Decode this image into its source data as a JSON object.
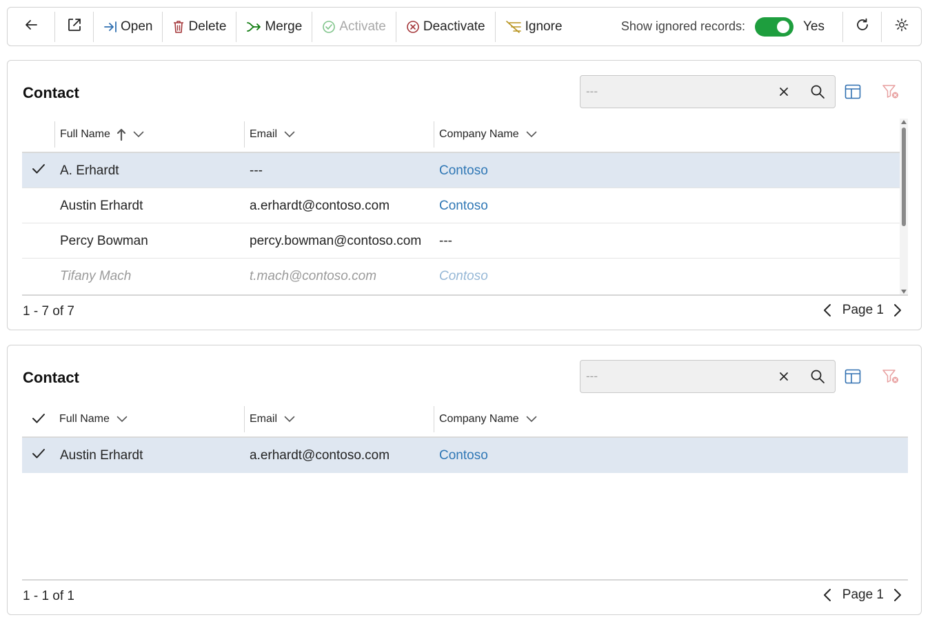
{
  "toolbar": {
    "open_label": "Open",
    "delete_label": "Delete",
    "merge_label": "Merge",
    "activate_label": "Activate",
    "deactivate_label": "Deactivate",
    "ignore_label": "Ignore",
    "show_ignored_label": "Show ignored records:",
    "show_ignored_value": "Yes",
    "colors": {
      "delete": "#a4373a",
      "merge": "#107c10",
      "activate": "#7fc48a",
      "deactivate": "#a4373a",
      "ignore": "#b8941f",
      "toggle": "#1e9e3e"
    }
  },
  "panel1": {
    "title": "Contact",
    "search_placeholder": "---",
    "columns": {
      "full_name": "Full Name",
      "email": "Email",
      "company": "Company Name"
    },
    "sort": {
      "column": "full_name",
      "direction": "ascending"
    },
    "rows": [
      {
        "full_name": "A. Erhardt",
        "email": "---",
        "company": "Contoso",
        "selected": true,
        "ignored": false
      },
      {
        "full_name": "Austin Erhardt",
        "email": "a.erhardt@contoso.com",
        "company": "Contoso",
        "selected": false,
        "ignored": false
      },
      {
        "full_name": "Percy Bowman",
        "email": "percy.bowman@contoso.com",
        "company": "---",
        "selected": false,
        "ignored": false
      },
      {
        "full_name": "Tifany Mach",
        "email": "t.mach@contoso.com",
        "company": "Contoso",
        "selected": false,
        "ignored": true
      }
    ],
    "count_text": "1 - 7 of 7",
    "page_label": "Page 1"
  },
  "panel2": {
    "title": "Contact",
    "search_placeholder": "---",
    "columns": {
      "full_name": "Full Name",
      "email": "Email",
      "company": "Company Name"
    },
    "rows": [
      {
        "full_name": "Austin Erhardt",
        "email": "a.erhardt@contoso.com",
        "company": "Contoso",
        "selected": true,
        "ignored": false
      }
    ],
    "count_text": "1 - 1 of 1",
    "page_label": "Page 1"
  },
  "icons": {
    "back": "arrow-left-icon",
    "popout": "open-in-new-window-icon",
    "open": "open-arrow-icon",
    "delete": "trash-icon",
    "merge": "merge-arrow-icon",
    "activate": "check-circle-icon",
    "deactivate": "x-circle-icon",
    "ignore": "ignore-lines-icon",
    "refresh": "refresh-icon",
    "settings": "gear-icon",
    "clear": "close-icon",
    "search": "search-icon",
    "columns": "edit-columns-icon",
    "filter_clear": "clear-filter-icon"
  }
}
